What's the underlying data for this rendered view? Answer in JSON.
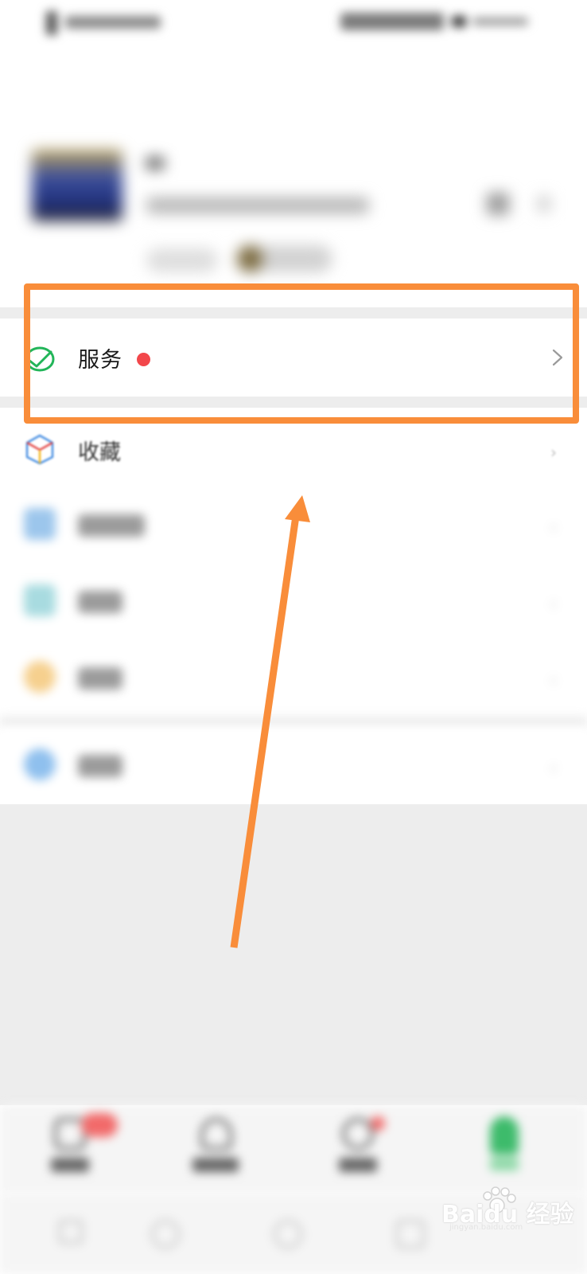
{
  "menu": {
    "service": {
      "label": "服务",
      "has_dot": true
    },
    "favorites": {
      "label": "收藏"
    }
  },
  "icons": {
    "service": "service-check-icon",
    "favorites": "favorites-cube-icon",
    "moments": "moments-icon",
    "cards": "cards-icon",
    "stickers": "stickers-icon",
    "settings": "settings-icon",
    "chevron": "chevron-right-icon"
  },
  "colors": {
    "annotation": "#f98d3a",
    "badge": "#f2474b",
    "service_icon": "#22b559",
    "me_tab": "#3dbb6b"
  },
  "watermark": {
    "logo": "Baidu 经验",
    "url": "jingyan.baidu.com"
  }
}
